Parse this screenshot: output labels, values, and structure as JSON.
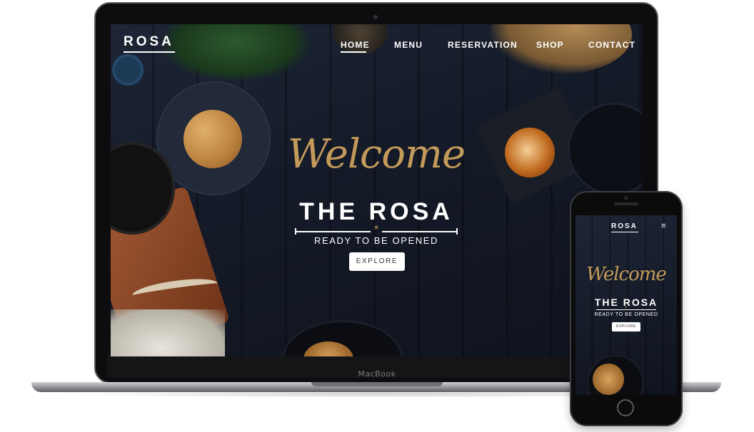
{
  "laptop": {
    "device_label": "MacBook",
    "site": {
      "logo": "ROSA",
      "nav": [
        {
          "label": "HOME",
          "active": true
        },
        {
          "label": "MENU",
          "active": false
        },
        {
          "label": "RESERVATION",
          "active": false
        },
        {
          "label": "SHOP",
          "active": false
        },
        {
          "label": "CONTACT",
          "active": false
        }
      ],
      "hero": {
        "script_title": "Welcome",
        "title": "THE ROSA",
        "ornament": "*",
        "subtitle": "READY TO BE OPENED",
        "cta": "EXPLORE"
      }
    }
  },
  "phone": {
    "site": {
      "logo": "ROSA",
      "menu_icon": "hamburger-icon",
      "menu_glyph": "≡",
      "hero": {
        "script_title": "Welcome",
        "title": "THE ROSA",
        "ornament": "*",
        "subtitle": "READY TO BE OPENED",
        "cta": "EXPLORE"
      }
    }
  },
  "colors": {
    "accent_gold": "#c39a5a",
    "background_dark": "#141a27",
    "text_white": "#ffffff"
  }
}
